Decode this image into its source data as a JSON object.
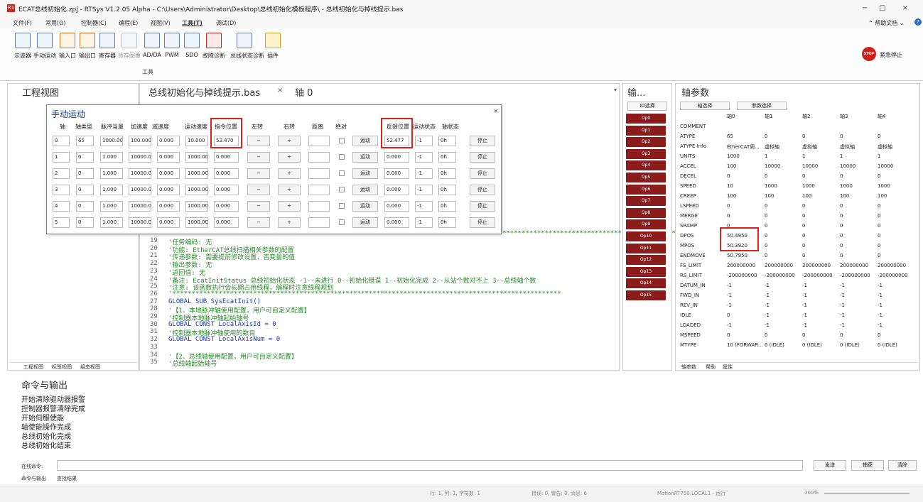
{
  "window": {
    "title": "ECAT总线初始化.zpj - RTSys V1.2.05 Alpha - C:\\Users\\Administrator\\Desktop\\总线初始化模板程序\\ - 总线初始化与掉线提示.bas",
    "logo": "R1",
    "min": "−",
    "restore": "▢",
    "close": "×"
  },
  "menu": [
    "文件(F)",
    "常用(O)",
    "控制器(C)",
    "编程(E)",
    "视图(V)",
    "工具(T)",
    "调试(D)"
  ],
  "help": {
    "label": "⌃ 帮助文档 ⌄",
    "icon": "?"
  },
  "ribbon": {
    "tools": [
      "示波器",
      "手动运动",
      "输入口",
      "输出口",
      "寄存器",
      "锁存图像",
      "AD/DA",
      "PWM",
      "SDO",
      "故障诊断",
      "总线状态诊断",
      "插件"
    ],
    "group": "工具",
    "estop": "紧急停止",
    "estop_icon": "STOP"
  },
  "project": {
    "title": "工程视图",
    "tabs": [
      "工程视图",
      "标签视图",
      "组态视图"
    ]
  },
  "editor": {
    "tab1": "总线初始化与掉线提示.bas",
    "tab2": "轴 0",
    "tab_close": "×",
    "dropdown": "▾"
  },
  "code": [
    {
      "n": "19",
      "t": "'任务编码:    无"
    },
    {
      "n": "20",
      "t": "'功能:       EtherCAT总线扫描相关参数的配置"
    },
    {
      "n": "21",
      "t": "'传递参数:    需要提前修改设置，否变量的值"
    },
    {
      "n": "22",
      "t": "'输出参数:    无"
    },
    {
      "n": "23",
      "t": "'返回值:     无"
    },
    {
      "n": "24",
      "t": "'备注:       EcatInitStatus    总线初始化状态   -1--未进行 0--初始化错误 1--初始化完成 2--从站个数对不上 3--总线轴个数"
    },
    {
      "n": "25",
      "t": "'注意:            该函数执行会长期占用线程，编程时注意线程规划"
    },
    {
      "n": "26",
      "t": "'*****************************************************************************************************"
    },
    {
      "n": "27",
      "t": "GLOBAL SUB SysEcatInit()"
    },
    {
      "n": "28",
      "t": "    '【1、本地脉冲轴使用配置，用户可自定义配置】"
    },
    {
      "n": "29",
      "t": "    '控制器本地脉冲轴起始轴号"
    },
    {
      "n": "30",
      "t": "    GLOBAL CONST LocalAxisId = 0"
    },
    {
      "n": "31",
      "t": "    '控制器本地脉冲轴使用的数目"
    },
    {
      "n": "32",
      "t": "    GLOBAL CONST LocalAxisNum = 0"
    },
    {
      "n": "33",
      "t": ""
    },
    {
      "n": "34",
      "t": "    '【2、总线轴使用配置，用户可自定义配置】"
    },
    {
      "n": "35",
      "t": "    '总线轴起始轴号"
    }
  ],
  "code_stars": "*****************************************************",
  "dialog": {
    "title": "手动运动",
    "close": "×",
    "headers": [
      "轴",
      "轴类型",
      "脉冲当量",
      "加速度",
      "减速度",
      "运动速度",
      "指令位置",
      "左转",
      "右转",
      "距离",
      "绝对",
      "",
      "反馈位置",
      "运动状态",
      "轴状态"
    ],
    "rows": [
      {
        "axis": "0",
        "type": "65",
        "units": "1000.00",
        "accel": "100.000",
        "decel": "0.000",
        "speed": "10.000",
        "dpos": "52.470",
        "dist": "",
        "run": "运动",
        "mpos": "52.477",
        "state": "-1",
        "status": "0h",
        "stop": "停止"
      },
      {
        "axis": "1",
        "type": "0",
        "units": "1.000",
        "accel": "10000.0",
        "decel": "0.000",
        "speed": "1000.00",
        "dpos": "0.000",
        "dist": "",
        "run": "运动",
        "mpos": "0.000",
        "state": "-1",
        "status": "0h",
        "stop": "停止"
      },
      {
        "axis": "2",
        "type": "0",
        "units": "1.000",
        "accel": "10000.0",
        "decel": "0.000",
        "speed": "1000.00",
        "dpos": "0.000",
        "dist": "",
        "run": "运动",
        "mpos": "0.000",
        "state": "-1",
        "status": "0h",
        "stop": "停止"
      },
      {
        "axis": "3",
        "type": "0",
        "units": "1.000",
        "accel": "10000.0",
        "decel": "0.000",
        "speed": "1000.00",
        "dpos": "0.000",
        "dist": "",
        "run": "运动",
        "mpos": "0.000",
        "state": "-1",
        "status": "0h",
        "stop": "停止"
      },
      {
        "axis": "4",
        "type": "0",
        "units": "1.000",
        "accel": "10000.0",
        "decel": "0.000",
        "speed": "1000.00",
        "dpos": "0.000",
        "dist": "",
        "run": "运动",
        "mpos": "0.000",
        "state": "-1",
        "status": "0h",
        "stop": "停止"
      },
      {
        "axis": "5",
        "type": "0",
        "units": "1.000",
        "accel": "10000.0",
        "decel": "0.000",
        "speed": "1000.00",
        "dpos": "0.000",
        "dist": "",
        "run": "运动",
        "mpos": "0.000",
        "state": "-1",
        "status": "0h",
        "stop": "停止"
      }
    ],
    "left": "−",
    "right": "+"
  },
  "io": {
    "title": "输...",
    "btn": "IO选择",
    "items": [
      "Op0",
      "Op1",
      "Op2",
      "Op3",
      "Op4",
      "Op5",
      "Op6",
      "Op7",
      "Op8",
      "Op9",
      "Op10",
      "Op11",
      "Op12",
      "Op13",
      "Op14",
      "Op15"
    ]
  },
  "axisparam": {
    "title": "轴参数",
    "btn1": "轴选择",
    "btn2": "参数选择",
    "cols": [
      "轴0",
      "轴1",
      "轴2",
      "轴3",
      "轴4"
    ],
    "rows": [
      [
        "COMMENT",
        "",
        "",
        "",
        "",
        ""
      ],
      [
        "ATYPE",
        "65",
        "0",
        "0",
        "0",
        "0"
      ],
      [
        "ATYPE Info",
        "EtherCAT周...",
        "虚拟轴",
        "虚拟轴",
        "虚拟轴",
        "虚拟轴"
      ],
      [
        "UNITS",
        "1000",
        "1",
        "1",
        "1",
        "1"
      ],
      [
        "ACCEL",
        "100",
        "10000",
        "10000",
        "10000",
        "10000"
      ],
      [
        "DECEL",
        "0",
        "0",
        "0",
        "0",
        "0"
      ],
      [
        "SPEED",
        "10",
        "1000",
        "1000",
        "1000",
        "1000"
      ],
      [
        "CREEP",
        "100",
        "100",
        "100",
        "100",
        "100"
      ],
      [
        "LSPEED",
        "0",
        "0",
        "0",
        "0",
        "0"
      ],
      [
        "MERGE",
        "0",
        "0",
        "0",
        "0",
        "0"
      ],
      [
        "SRAMP",
        "0",
        "0",
        "0",
        "0",
        "0"
      ],
      [
        "DPOS",
        "50.4950",
        "0",
        "0",
        "0",
        "0"
      ],
      [
        "MPOS",
        "50.3920",
        "0",
        "0",
        "0",
        "0"
      ],
      [
        "ENDMOVE",
        "50.7950",
        "0",
        "0",
        "0",
        "0"
      ],
      [
        "FS_LIMIT",
        "200000000",
        "200000000",
        "200000000",
        "200000000",
        "200000000"
      ],
      [
        "RS_LIMIT",
        "-200000000",
        "-200000000",
        "-200000000",
        "-200000000",
        "-200000000"
      ],
      [
        "DATUM_IN",
        "-1",
        "-1",
        "-1",
        "-1",
        "-1"
      ],
      [
        "FWD_IN",
        "-1",
        "-1",
        "-1",
        "-1",
        "-1"
      ],
      [
        "REV_IN",
        "-1",
        "-1",
        "-1",
        "-1",
        "-1"
      ],
      [
        "IDLE",
        "0",
        "-1",
        "-1",
        "-1",
        "-1"
      ],
      [
        "LOADED",
        "-1",
        "-1",
        "-1",
        "-1",
        "-1"
      ],
      [
        "MSPEED",
        "0",
        "0",
        "0",
        "0",
        "0"
      ],
      [
        "MTYPE",
        "10 (FORWAR...",
        "0 (IDLE)",
        "0 (IDLE)",
        "0 (IDLE)",
        "0 (IDLE)"
      ]
    ],
    "tabs": [
      "轴参数",
      "帮助",
      "属性"
    ]
  },
  "cmd": {
    "title": "命令与输出",
    "lines": [
      "开始清除驱动器报警",
      "控制器报警清除完成",
      "开始伺服使能",
      "轴使能操作完成",
      "总线初始化完成",
      "总线初始化结束"
    ],
    "online_label": "在线命令:",
    "send": "发送",
    "capture": "捕获",
    "clear": "清除",
    "tabs": [
      "命令与输出",
      "查找结果"
    ]
  },
  "status": {
    "pos": "行: 1, 列: 1, 字符数: 1",
    "errors": "错误: 0, 警告: 0, 消息: 6",
    "conn": "MotionRT750:LOCAL1 - 运行",
    "zoom": "100%"
  }
}
